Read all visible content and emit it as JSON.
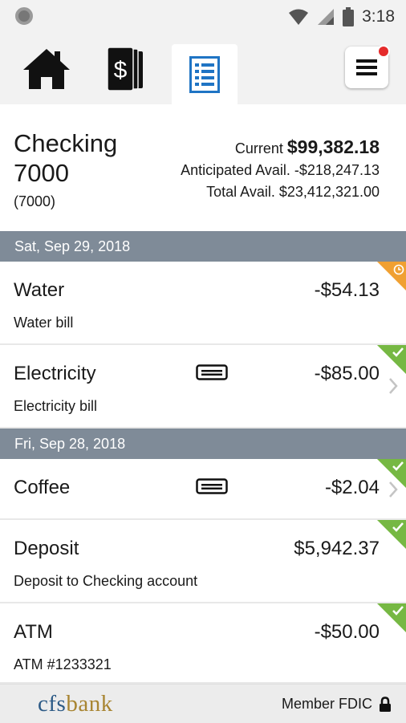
{
  "status_bar": {
    "time": "3:18"
  },
  "nav": {
    "home_icon": "home-icon",
    "accounts_icon": "dollar-cards-icon",
    "activity_icon": "document-list-icon",
    "menu_icon": "hamburger-menu-icon",
    "active": "activity"
  },
  "account": {
    "name": "Checking 7000",
    "number": "(7000)",
    "current_label": "Current",
    "current_value": "$99,382.18",
    "anticipated_label": "Anticipated Avail.",
    "anticipated_value": "-$218,247.13",
    "total_label": "Total Avail.",
    "total_value": "$23,412,321.00"
  },
  "groups": [
    {
      "date": "Sat, Sep 29, 2018",
      "transactions": [
        {
          "name": "Water",
          "description": "Water bill",
          "amount": "-$54.13",
          "status": "pending"
        },
        {
          "name": "Electricity",
          "description": "Electricity bill",
          "amount": "-$85.00",
          "status": "cleared"
        }
      ]
    },
    {
      "date": "Fri, Sep 28, 2018",
      "transactions": [
        {
          "name": "Coffee",
          "description": "",
          "amount": "-$2.04",
          "status": "cleared"
        },
        {
          "name": "Deposit",
          "description": "Deposit to Checking account",
          "amount": "$5,942.37",
          "status": "cleared"
        },
        {
          "name": "ATM",
          "description": "ATM #1233321",
          "amount": "-$50.00",
          "status": "cleared"
        }
      ]
    }
  ],
  "footer": {
    "logo_part1": "cfs",
    "logo_part2": "bank",
    "member_text": "Member FDIC"
  },
  "colors": {
    "accent_blue": "#1f74c4",
    "date_bar": "#7f8b98",
    "cleared_green": "#76b843",
    "pending_orange": "#f0a032",
    "notification_red": "#e52b2b"
  }
}
